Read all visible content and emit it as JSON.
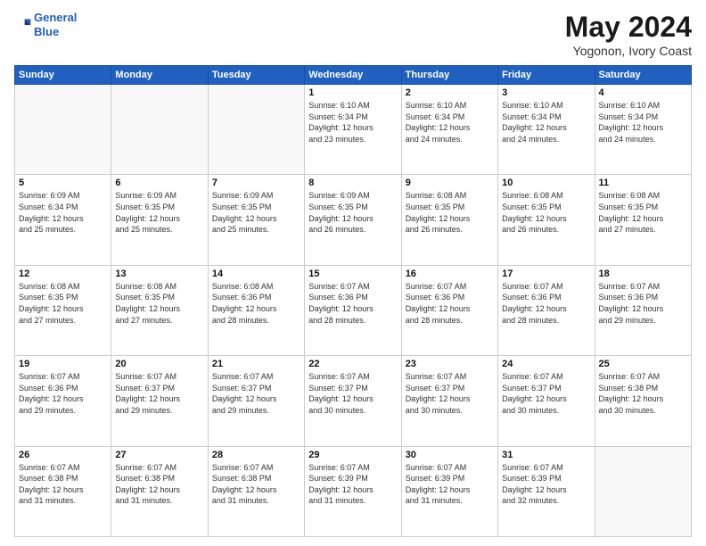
{
  "header": {
    "logo_line1": "General",
    "logo_line2": "Blue",
    "title": "May 2024",
    "subtitle": "Yogonon, Ivory Coast"
  },
  "weekdays": [
    "Sunday",
    "Monday",
    "Tuesday",
    "Wednesday",
    "Thursday",
    "Friday",
    "Saturday"
  ],
  "weeks": [
    [
      {
        "day": "",
        "info": ""
      },
      {
        "day": "",
        "info": ""
      },
      {
        "day": "",
        "info": ""
      },
      {
        "day": "1",
        "info": "Sunrise: 6:10 AM\nSunset: 6:34 PM\nDaylight: 12 hours\nand 23 minutes."
      },
      {
        "day": "2",
        "info": "Sunrise: 6:10 AM\nSunset: 6:34 PM\nDaylight: 12 hours\nand 24 minutes."
      },
      {
        "day": "3",
        "info": "Sunrise: 6:10 AM\nSunset: 6:34 PM\nDaylight: 12 hours\nand 24 minutes."
      },
      {
        "day": "4",
        "info": "Sunrise: 6:10 AM\nSunset: 6:34 PM\nDaylight: 12 hours\nand 24 minutes."
      }
    ],
    [
      {
        "day": "5",
        "info": "Sunrise: 6:09 AM\nSunset: 6:34 PM\nDaylight: 12 hours\nand 25 minutes."
      },
      {
        "day": "6",
        "info": "Sunrise: 6:09 AM\nSunset: 6:35 PM\nDaylight: 12 hours\nand 25 minutes."
      },
      {
        "day": "7",
        "info": "Sunrise: 6:09 AM\nSunset: 6:35 PM\nDaylight: 12 hours\nand 25 minutes."
      },
      {
        "day": "8",
        "info": "Sunrise: 6:09 AM\nSunset: 6:35 PM\nDaylight: 12 hours\nand 26 minutes."
      },
      {
        "day": "9",
        "info": "Sunrise: 6:08 AM\nSunset: 6:35 PM\nDaylight: 12 hours\nand 26 minutes."
      },
      {
        "day": "10",
        "info": "Sunrise: 6:08 AM\nSunset: 6:35 PM\nDaylight: 12 hours\nand 26 minutes."
      },
      {
        "day": "11",
        "info": "Sunrise: 6:08 AM\nSunset: 6:35 PM\nDaylight: 12 hours\nand 27 minutes."
      }
    ],
    [
      {
        "day": "12",
        "info": "Sunrise: 6:08 AM\nSunset: 6:35 PM\nDaylight: 12 hours\nand 27 minutes."
      },
      {
        "day": "13",
        "info": "Sunrise: 6:08 AM\nSunset: 6:35 PM\nDaylight: 12 hours\nand 27 minutes."
      },
      {
        "day": "14",
        "info": "Sunrise: 6:08 AM\nSunset: 6:36 PM\nDaylight: 12 hours\nand 28 minutes."
      },
      {
        "day": "15",
        "info": "Sunrise: 6:07 AM\nSunset: 6:36 PM\nDaylight: 12 hours\nand 28 minutes."
      },
      {
        "day": "16",
        "info": "Sunrise: 6:07 AM\nSunset: 6:36 PM\nDaylight: 12 hours\nand 28 minutes."
      },
      {
        "day": "17",
        "info": "Sunrise: 6:07 AM\nSunset: 6:36 PM\nDaylight: 12 hours\nand 28 minutes."
      },
      {
        "day": "18",
        "info": "Sunrise: 6:07 AM\nSunset: 6:36 PM\nDaylight: 12 hours\nand 29 minutes."
      }
    ],
    [
      {
        "day": "19",
        "info": "Sunrise: 6:07 AM\nSunset: 6:36 PM\nDaylight: 12 hours\nand 29 minutes."
      },
      {
        "day": "20",
        "info": "Sunrise: 6:07 AM\nSunset: 6:37 PM\nDaylight: 12 hours\nand 29 minutes."
      },
      {
        "day": "21",
        "info": "Sunrise: 6:07 AM\nSunset: 6:37 PM\nDaylight: 12 hours\nand 29 minutes."
      },
      {
        "day": "22",
        "info": "Sunrise: 6:07 AM\nSunset: 6:37 PM\nDaylight: 12 hours\nand 30 minutes."
      },
      {
        "day": "23",
        "info": "Sunrise: 6:07 AM\nSunset: 6:37 PM\nDaylight: 12 hours\nand 30 minutes."
      },
      {
        "day": "24",
        "info": "Sunrise: 6:07 AM\nSunset: 6:37 PM\nDaylight: 12 hours\nand 30 minutes."
      },
      {
        "day": "25",
        "info": "Sunrise: 6:07 AM\nSunset: 6:38 PM\nDaylight: 12 hours\nand 30 minutes."
      }
    ],
    [
      {
        "day": "26",
        "info": "Sunrise: 6:07 AM\nSunset: 6:38 PM\nDaylight: 12 hours\nand 31 minutes."
      },
      {
        "day": "27",
        "info": "Sunrise: 6:07 AM\nSunset: 6:38 PM\nDaylight: 12 hours\nand 31 minutes."
      },
      {
        "day": "28",
        "info": "Sunrise: 6:07 AM\nSunset: 6:38 PM\nDaylight: 12 hours\nand 31 minutes."
      },
      {
        "day": "29",
        "info": "Sunrise: 6:07 AM\nSunset: 6:39 PM\nDaylight: 12 hours\nand 31 minutes."
      },
      {
        "day": "30",
        "info": "Sunrise: 6:07 AM\nSunset: 6:39 PM\nDaylight: 12 hours\nand 31 minutes."
      },
      {
        "day": "31",
        "info": "Sunrise: 6:07 AM\nSunset: 6:39 PM\nDaylight: 12 hours\nand 32 minutes."
      },
      {
        "day": "",
        "info": ""
      }
    ]
  ]
}
